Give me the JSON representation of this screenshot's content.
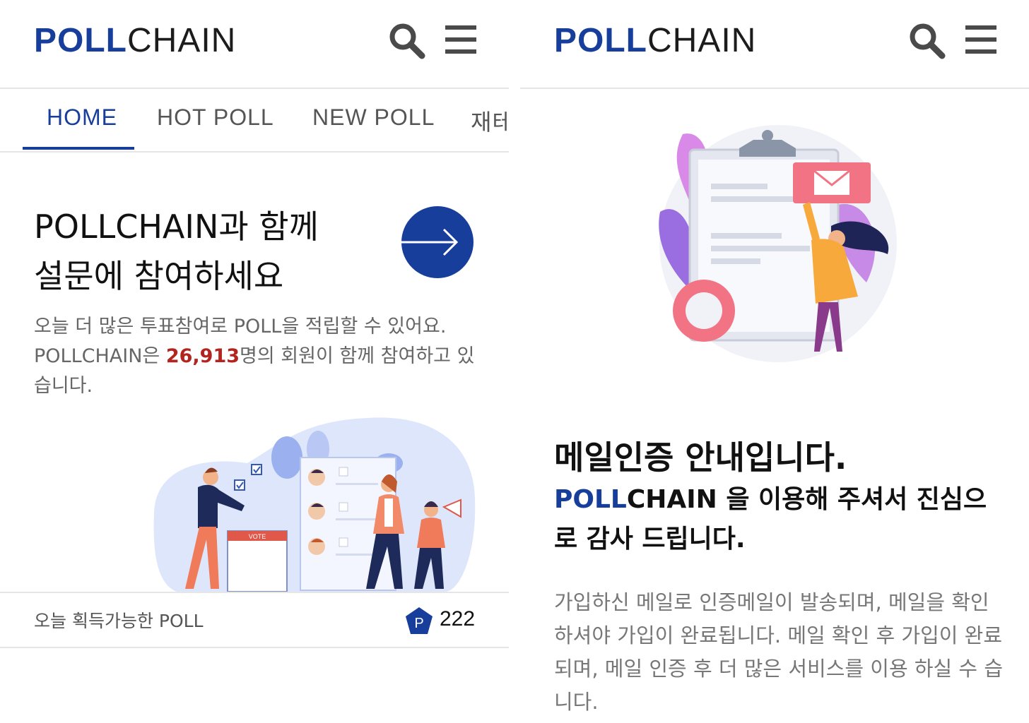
{
  "brand": {
    "bold": "POLL",
    "light": "CHAIN"
  },
  "colors": {
    "primary": "#183e9b",
    "highlight": "#b3241f",
    "divider": "#e6e6e6"
  },
  "icons": {
    "search": "search-icon",
    "menu": "hamburger-menu-icon",
    "next": "arrow-right-icon",
    "points": "point-badge-icon"
  },
  "home": {
    "tabs": [
      {
        "label": "HOME",
        "active": true
      },
      {
        "label": "HOT POLL",
        "active": false
      },
      {
        "label": "NEW POLL",
        "active": false
      },
      {
        "label": "재테",
        "active": false
      }
    ],
    "hero": {
      "title_line1": "POLLCHAIN과 함께",
      "title_line2": "설문에 참여하세요",
      "desc_line1": "오늘 더 많은 투표참여로 POLL을 적립할 수 있어요.",
      "desc_pre": "POLLCHAIN은 ",
      "member_count": "26,913",
      "desc_post": "명의 회원이 함께 참여하고 있습니다."
    },
    "illustration_text": "VOTE",
    "points": {
      "label": "오늘 획득가능한 POLL",
      "badge": "P",
      "value": "222"
    }
  },
  "mail": {
    "title": "메일인증 안내입니다.",
    "subtitle_brand_bold": "POLL",
    "subtitle_brand_light": "CHAIN",
    "subtitle_rest": " 을 이용해 주셔서 진심으로 감사 드립니다.",
    "body": "가입하신 메일로 인증메일이 발송되며, 메일을 확인하셔야 가입이 완료됩니다. 메일 확인 후 가입이 완료되며, 메일 인증 후 더 많은 서비스를 이용 하실 수 습니다."
  }
}
